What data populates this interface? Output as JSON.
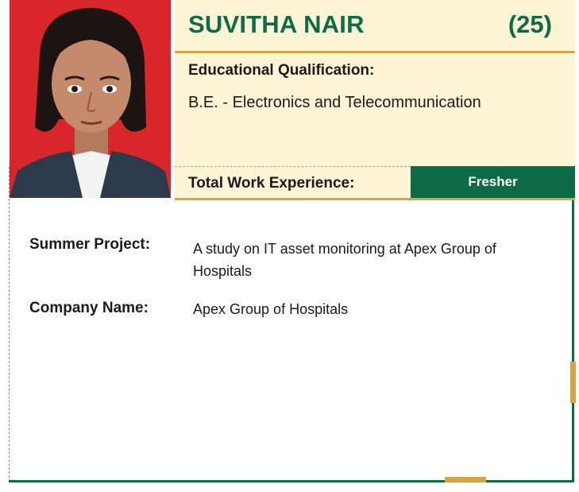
{
  "profile": {
    "name": "SUVITHA NAIR",
    "number": "(25)",
    "photo_icon": "person-portrait-icon"
  },
  "education": {
    "label": "Educational Qualification:",
    "value": "B.E. - Electronics and Telecommunication"
  },
  "experience": {
    "label": "Total Work Experience:",
    "value": "Fresher"
  },
  "summer_project": {
    "label": "Summer Project:",
    "value": "A study on IT asset monitoring at Apex  Group of Hospitals"
  },
  "company": {
    "label": "Company Name:",
    "value": "Apex  Group of Hospitals"
  },
  "colors": {
    "brand_green": "#0d6b45",
    "accent_gold": "#d3a548",
    "panel_cream": "#fdf4d6",
    "photo_background": "#d8262b"
  }
}
